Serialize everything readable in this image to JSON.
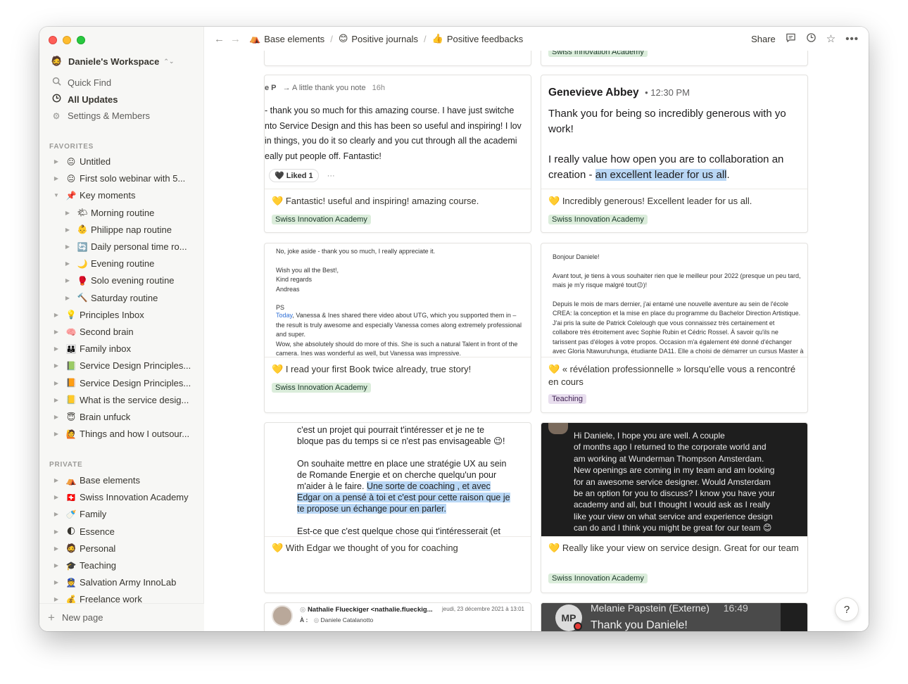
{
  "workspace": {
    "name": "Daniele's Workspace",
    "emoji": "🧔"
  },
  "sidebar": {
    "quick_find": "Quick Find",
    "all_updates": "All Updates",
    "settings": "Settings & Members",
    "favorites_label": "FAVORITES",
    "private_label": "PRIVATE",
    "new_page": "New page",
    "favorites": [
      {
        "emoji": "😐",
        "label": "Untitled"
      },
      {
        "emoji": "😐",
        "label": "First solo webinar with 5..."
      },
      {
        "emoji": "📌",
        "label": "Key moments"
      },
      {
        "emoji": "🌤",
        "label": "Morning routine"
      },
      {
        "emoji": "👶",
        "label": "Philippe nap routine"
      },
      {
        "emoji": "🔄",
        "label": "Daily personal time ro..."
      },
      {
        "emoji": "🌙",
        "label": "Evening routine"
      },
      {
        "emoji": "🥊",
        "label": "Solo evening routine"
      },
      {
        "emoji": "🔨",
        "label": "Saturday routine"
      },
      {
        "emoji": "💡",
        "label": "Principles Inbox"
      },
      {
        "emoji": "🧠",
        "label": "Second brain"
      },
      {
        "emoji": "👪",
        "label": "Family inbox"
      },
      {
        "emoji": "📗",
        "label": "Service Design Principles..."
      },
      {
        "emoji": "📙",
        "label": "Service Design Principles..."
      },
      {
        "emoji": "📒",
        "label": "What is the service desig..."
      },
      {
        "emoji": "😇",
        "label": "Brain unfuck"
      },
      {
        "emoji": "🙋",
        "label": "Things and how I outsour..."
      }
    ],
    "private": [
      {
        "emoji": "⛺",
        "label": "Base elements"
      },
      {
        "emoji": "🇨🇭",
        "label": "Swiss Innovation Academy"
      },
      {
        "emoji": "🍼",
        "label": "Family"
      },
      {
        "emoji": "🌓",
        "label": "Essence"
      },
      {
        "emoji": "🧔",
        "label": "Personal"
      },
      {
        "emoji": "🎓",
        "label": "Teaching"
      },
      {
        "emoji": "👮",
        "label": "Salvation Army InnoLab"
      },
      {
        "emoji": "💰",
        "label": "Freelance work"
      }
    ]
  },
  "topbar": {
    "crumbs": [
      {
        "emoji": "⛺",
        "label": "Base elements"
      },
      {
        "emoji": "😊",
        "label": "Positive journals"
      },
      {
        "emoji": "👍",
        "label": "Positive feedbacks"
      }
    ],
    "share": "Share"
  },
  "cards": {
    "top_tag": "Swiss Innovation Academy",
    "c1": {
      "sender": "e P",
      "arrow": "→ A little thank you note",
      "time": "16h",
      "l1": "- thank you so much for this amazing course. I have just switche",
      "l2": "nto Service Design and this has been so useful and inspiring! I lov",
      "l3": "in things, you do it so clearly and you cut through all the academi",
      "l4": "eally put people off. Fantastic!",
      "liked": "Liked 1",
      "more": "···",
      "caption": "Fantastic! useful and inspiring! amazing course.",
      "tag": "Swiss Innovation Academy"
    },
    "c2": {
      "name": "Genevieve Abbey",
      "time": "• 12:30 PM",
      "l1": "Thank you for being so incredibly generous with yo",
      "l2": "work!",
      "l3": "I really value how open you are to collaboration an",
      "l4a": "creation - ",
      "l4b": "an excellent leader for us all",
      "l4c": ".",
      "caption": "Incredibly generous! Excellent leader for us all.",
      "tag": "Swiss Innovation Academy"
    },
    "c3": {
      "lines": [
        "No, joke aside - thank you so much, I really appreciate it.",
        "",
        "Wish you all the Best!,",
        "Kind regards",
        "Andreas",
        "",
        "PS"
      ],
      "today": "Today",
      "l8": ", Vanessa & Ines shared there video about UTG, which you supported them in –",
      "l9": "the result is truly awesome and especially Vanessa comes along extremely professional",
      "l10": "and super.",
      "l11": "Wow, she absolutely should do more of this. She is such a natural Talent in front of the",
      "l12": "camera. Ines was wonderful as well, but Vanessa was impressive.",
      "caption": "I read your first Book twice already, true story!",
      "tag": "Swiss Innovation Academy"
    },
    "c4": {
      "lines": [
        "Bonjour Daniele!",
        "",
        "Avant tout, je tiens à vous souhaiter rien que le meilleur pour 2022 (presque un peu tard,",
        "mais je m'y risque malgré tout😉)!",
        "",
        "Depuis le mois de mars dernier, j'ai entamé une nouvelle aventure au sein de l'école",
        "CREA: la conception et la mise en place du programme du Bachelor Direction Artistique.",
        "J'ai pris la suite de Patrick Colelough que vous connaissez très certainement et",
        "collabore très étroitement avec Sophie Rubin et Cédric Rossel. À savoir qu'ils ne",
        "tarissent pas d'éloges à votre propos. Occasion m'a également été donné d'échanger",
        "avec Gloria Ntawuruhunga, étudiante DA11. Elle a choisi de démarrer un cursus Master à"
      ],
      "caption": "« révélation professionnelle » lorsqu'elle vous a rencontré en cours",
      "tag": "Teaching"
    },
    "c5": {
      "l1": "c'est un projet qui pourrait t'intéresser et je ne te",
      "l2": "bloque pas du temps si ce n'est pas envisageable 😉!",
      "l3": "On souhaite mettre en place une stratégie UX au sein",
      "l4": "de Romande Energie et on cherche quelqu'un pour",
      "l5a": "m'aider à le faire. ",
      "l5b": "Une sorte de coaching , et avec",
      "l6": "Edgar on a pensé à toi et c'est pour cette raison que je",
      "l7": "te propose un échange pour en parler.",
      "l8": "Est-ce que c'est quelque chose qui t'intéresserait (et",
      "caption": "With Edgar we thought of you for coaching"
    },
    "c6": {
      "lines": [
        "Hi Daniele, I hope you are well. A couple",
        "of months ago I returned to the corporate world and",
        "am working at Wunderman Thompson Amsterdam.",
        "New openings are coming in my team and am looking",
        "for an awesome service designer. Would Amsterdam",
        "be an option for you to discuss? I know you have your",
        "academy and all, but I thought I would ask as I really",
        "like your view on what service and experience design",
        "can do and I think you might be great for our team 😊"
      ],
      "caption": "Really like your view on service design. Great for our team",
      "tag": "Swiss Innovation Academy"
    },
    "c7": {
      "from": "Nathalie Flueckiger <nathalie.flueckig...",
      "date": "jeudi, 23 décembre 2021 à 13:01",
      "to_label": "À :",
      "to": "Daniele Catalanotto"
    },
    "c8": {
      "initials": "MP",
      "name": "Melanie Papstein (Externe)",
      "time": "16:49",
      "message": "Thank you Daniele!"
    }
  },
  "help": "?"
}
